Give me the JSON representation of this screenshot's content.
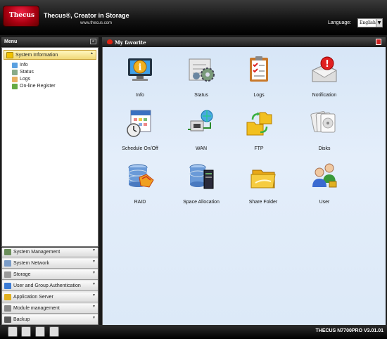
{
  "header": {
    "logo": "Thecus",
    "tagline": "Thecus®, Creator in Storage",
    "website": "www.thecus.com",
    "language_label": "Language:",
    "language_value": "English"
  },
  "sidebar": {
    "title": "Menu",
    "open_category": "System Information",
    "sub_items": [
      "Info",
      "Status",
      "Logs",
      "On-line Register"
    ],
    "categories": [
      "System Management",
      "System Network",
      "Storage",
      "User and Group Authentication",
      "Application Server",
      "Module management",
      "Backup"
    ]
  },
  "favorites": {
    "title": "My favorite",
    "tiles": [
      {
        "label": "Info",
        "icon": "info-monitor-icon"
      },
      {
        "label": "Status",
        "icon": "status-gears-icon"
      },
      {
        "label": "Logs",
        "icon": "logs-clipboard-icon"
      },
      {
        "label": "Notification",
        "icon": "notification-mail-icon"
      },
      {
        "label": "Schedule On/Off",
        "icon": "schedule-calendar-icon"
      },
      {
        "label": "WAN",
        "icon": "wan-network-icon"
      },
      {
        "label": "FTP",
        "icon": "ftp-folder-icon"
      },
      {
        "label": "Disks",
        "icon": "disks-icon"
      },
      {
        "label": "RAID",
        "icon": "raid-database-icon"
      },
      {
        "label": "Space Allocation",
        "icon": "space-allocation-icon"
      },
      {
        "label": "Share Folder",
        "icon": "share-folder-icon"
      },
      {
        "label": "User",
        "icon": "users-icon"
      }
    ]
  },
  "footer": {
    "version": "THECUS N7700PRO V3.01.01"
  },
  "colors": {
    "accent_red": "#cc1122",
    "panel_blue": "#dce9f8",
    "header_black": "#111111"
  }
}
